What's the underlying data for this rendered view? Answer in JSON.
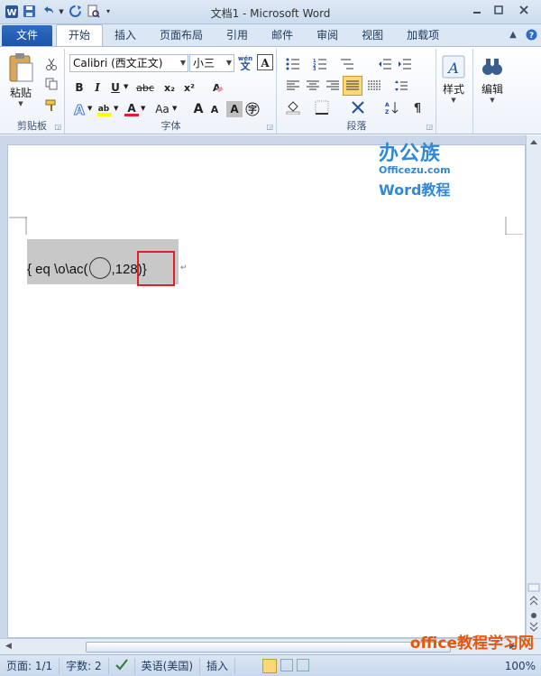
{
  "window": {
    "title": "文档1 - Microsoft Word"
  },
  "quick_access": {
    "icons": [
      "word-app-icon",
      "save-icon",
      "undo-icon",
      "redo-icon",
      "print-preview-icon",
      "customize-icon"
    ]
  },
  "ribbon_tabs": {
    "file": "文件",
    "tabs": [
      "开始",
      "插入",
      "页面布局",
      "引用",
      "邮件",
      "审阅",
      "视图",
      "加载项"
    ],
    "active": "开始"
  },
  "clipboard": {
    "paste": "粘贴",
    "label": "剪贴板"
  },
  "font": {
    "family": "Calibri (西文正文)",
    "size": "小三",
    "label": "字体",
    "bold": "B",
    "italic": "I",
    "underline": "U",
    "strike": "abc",
    "subscript": "x₂",
    "superscript": "x²",
    "change_case": "Aa",
    "grow": "A",
    "shrink": "A",
    "char_shading": "A"
  },
  "paragraph": {
    "label": "段落"
  },
  "styles": {
    "label": "样式"
  },
  "editing": {
    "label": "编辑"
  },
  "document": {
    "field_open": "{ eq \\o\\ac(",
    "field_value": ",128",
    "field_close": ")}",
    "paragraph_mark": "↵"
  },
  "watermark": {
    "brand": "办公族",
    "site": "Officezu.com",
    "tagline": "Word教程",
    "footer_site": "office教程学习网"
  },
  "status_bar": {
    "page": "页面: 1/1",
    "words": "字数: 2",
    "language": "英语(美国)",
    "mode": "插入",
    "zoom": "100%"
  },
  "colors": {
    "accent": "#2b5797",
    "file_tab": "#1d55a8",
    "highlight_border": "#e01f26",
    "field_shading": "#c8c8c8"
  }
}
